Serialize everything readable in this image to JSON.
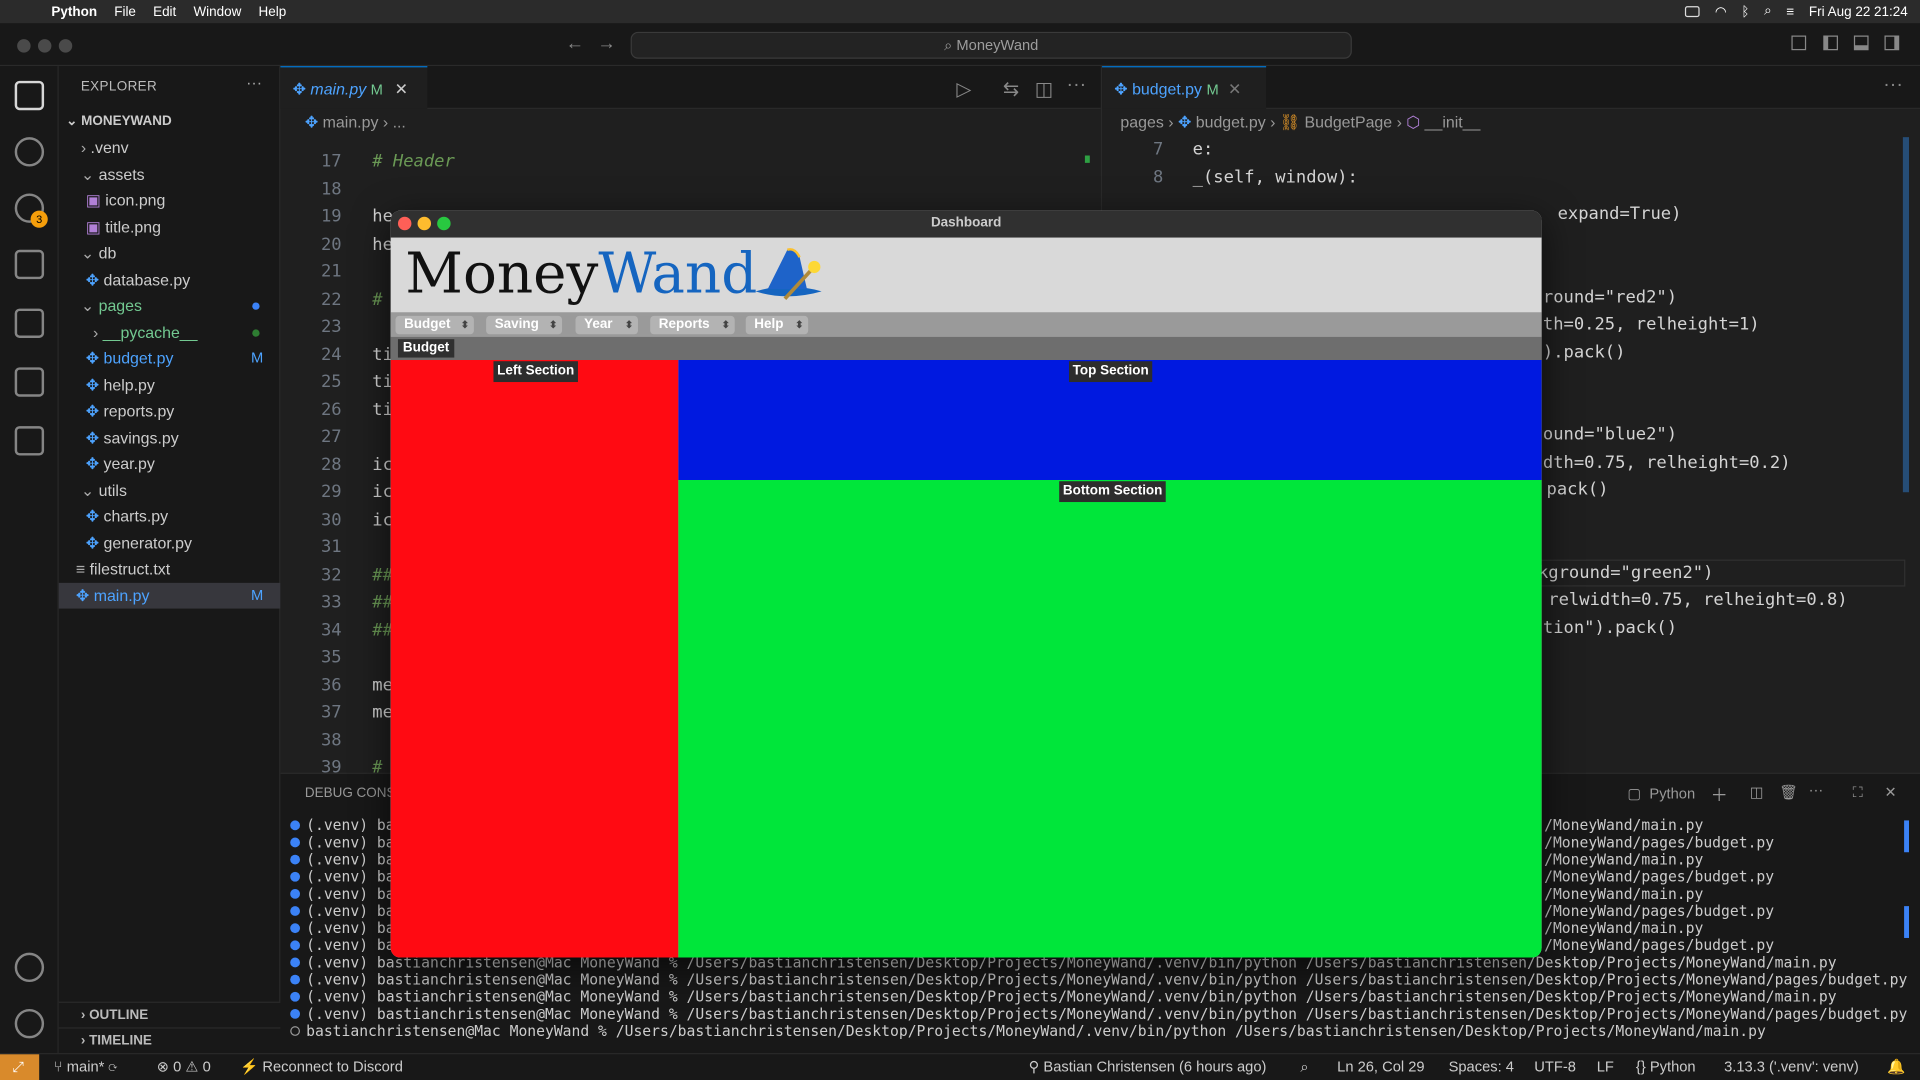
{
  "menubar": {
    "app": "Python",
    "items": [
      "File",
      "Edit",
      "Window",
      "Help"
    ],
    "clock": "Fri Aug 22 21:24"
  },
  "window": {
    "search": "MoneyWand"
  },
  "activity": {
    "badge": "3"
  },
  "explorer": {
    "header": "EXPLORER",
    "root": "MONEYWAND",
    "items": [
      {
        "label": ".venv"
      },
      {
        "label": "assets"
      },
      {
        "label": "icon.png"
      },
      {
        "label": "title.png"
      },
      {
        "label": "db"
      },
      {
        "label": "database.py"
      },
      {
        "label": "pages"
      },
      {
        "label": "__pycache__"
      },
      {
        "label": "budget.py",
        "mark": "M"
      },
      {
        "label": "help.py"
      },
      {
        "label": "reports.py"
      },
      {
        "label": "savings.py"
      },
      {
        "label": "year.py"
      },
      {
        "label": "utils"
      },
      {
        "label": "charts.py"
      },
      {
        "label": "generator.py"
      },
      {
        "label": "filestruct.txt"
      },
      {
        "label": "main.py",
        "mark": "M"
      }
    ],
    "outline": "OUTLINE",
    "timeline": "TIMELINE"
  },
  "editor_left": {
    "tab": "main.py",
    "tab_mark": "M",
    "breadcrumb": "main.py",
    "breadcrumb_more": "...",
    "lines": [
      {
        "n": "17",
        "t": "# Header"
      },
      {
        "n": "18",
        "t": ""
      },
      {
        "n": "19",
        "t": "he"
      },
      {
        "n": "20",
        "t": "he"
      },
      {
        "n": "21",
        "t": ""
      },
      {
        "n": "22",
        "t": "#"
      },
      {
        "n": "23",
        "t": ""
      },
      {
        "n": "24",
        "t": "ti"
      },
      {
        "n": "25",
        "t": "ti"
      },
      {
        "n": "26",
        "t": "ti"
      },
      {
        "n": "27",
        "t": ""
      },
      {
        "n": "28",
        "t": "ic"
      },
      {
        "n": "29",
        "t": "ic"
      },
      {
        "n": "30",
        "t": "ic"
      },
      {
        "n": "31",
        "t": ""
      },
      {
        "n": "32",
        "t": "##"
      },
      {
        "n": "33",
        "t": "##"
      },
      {
        "n": "34",
        "t": "##"
      },
      {
        "n": "35",
        "t": ""
      },
      {
        "n": "36",
        "t": "me"
      },
      {
        "n": "37",
        "t": "me"
      },
      {
        "n": "38",
        "t": ""
      },
      {
        "n": "39",
        "t": "#"
      }
    ]
  },
  "editor_right": {
    "tab": "budget.py",
    "tab_mark": "M",
    "crumbs": [
      "pages",
      "budget.py",
      "BudgetPage",
      "__init__"
    ],
    "lines": [
      {
        "n": "7",
        "t": "e:"
      },
      {
        "n": "8",
        "t": "_(self, window):"
      }
    ],
    "frags": [
      "expand=True)",
      "round=\"red2\")",
      "th=0.25, relheight=1)",
      ").pack()",
      "ound=\"blue2\")",
      "dth=0.75, relheight=0.2)",
      "pack()",
      "kground=\"green2\")",
      " relwidth=0.75, relheight=0.8)",
      "tion\").pack()"
    ]
  },
  "panel": {
    "title": "DEBUG CONS",
    "terminal_name": "Python",
    "short_lines": [
      {
        "l": "(.venv) bas",
        "r": "/MoneyWand/main.py"
      },
      {
        "l": "(.venv) bas",
        "r": "/MoneyWand/pages/budget.py"
      },
      {
        "l": "(.venv) bas",
        "r": "/MoneyWand/main.py"
      },
      {
        "l": "(.venv) bas",
        "r": "/MoneyWand/pages/budget.py"
      },
      {
        "l": "(.venv) bas",
        "r": "/MoneyWand/main.py"
      },
      {
        "l": "(.venv) bas",
        "r": "/MoneyWand/pages/budget.py"
      },
      {
        "l": "(.venv) bas",
        "r": "/MoneyWand/main.py"
      },
      {
        "l": "(.venv) bas",
        "r": "/MoneyWand/pages/budget.py"
      }
    ],
    "full_lines": [
      "(.venv) bastianchristensen@Mac MoneyWand % /Users/bastianchristensen/Desktop/Projects/MoneyWand/.venv/bin/python /Users/bastianchristensen/Desktop/Projects/MoneyWand/main.py",
      "(.venv) bastianchristensen@Mac MoneyWand % /Users/bastianchristensen/Desktop/Projects/MoneyWand/.venv/bin/python /Users/bastianchristensen/Desktop/Projects/MoneyWand/pages/budget.py",
      "(.venv) bastianchristensen@Mac MoneyWand % /Users/bastianchristensen/Desktop/Projects/MoneyWand/.venv/bin/python /Users/bastianchristensen/Desktop/Projects/MoneyWand/main.py",
      "(.venv) bastianchristensen@Mac MoneyWand % /Users/bastianchristensen/Desktop/Projects/MoneyWand/.venv/bin/python /Users/bastianchristensen/Desktop/Projects/MoneyWand/pages/budget.py",
      "bastianchristensen@Mac MoneyWand % /Users/bastianchristensen/Desktop/Projects/MoneyWand/.venv/bin/python /Users/bastianchristensen/Desktop/Projects/MoneyWand/main.py"
    ]
  },
  "status": {
    "branch": "main*",
    "problems": "0",
    "warnings": "0",
    "discord": "Reconnect to Discord",
    "blame": "Bastian Christensen (6 hours ago)",
    "cursor": "Ln 26, Col 29",
    "spaces": "Spaces: 4",
    "encoding": "UTF-8",
    "eol": "LF",
    "lang": "Python",
    "interpreter": "3.13.3 ('.venv': venv)"
  },
  "dashboard": {
    "title": "Dashboard",
    "logo_a": "Money",
    "logo_b": "Wand",
    "menus": [
      "Budget",
      "Saving",
      "Year",
      "Reports",
      "Help"
    ],
    "active_tab": "Budget",
    "left_label": "Left Section",
    "top_label": "Top Section",
    "bottom_label": "Bottom Section",
    "colors": {
      "left": "#ff0a12",
      "top": "#0019e0",
      "bottom": "#00e63a",
      "logo_accent": "#1565c0"
    }
  }
}
